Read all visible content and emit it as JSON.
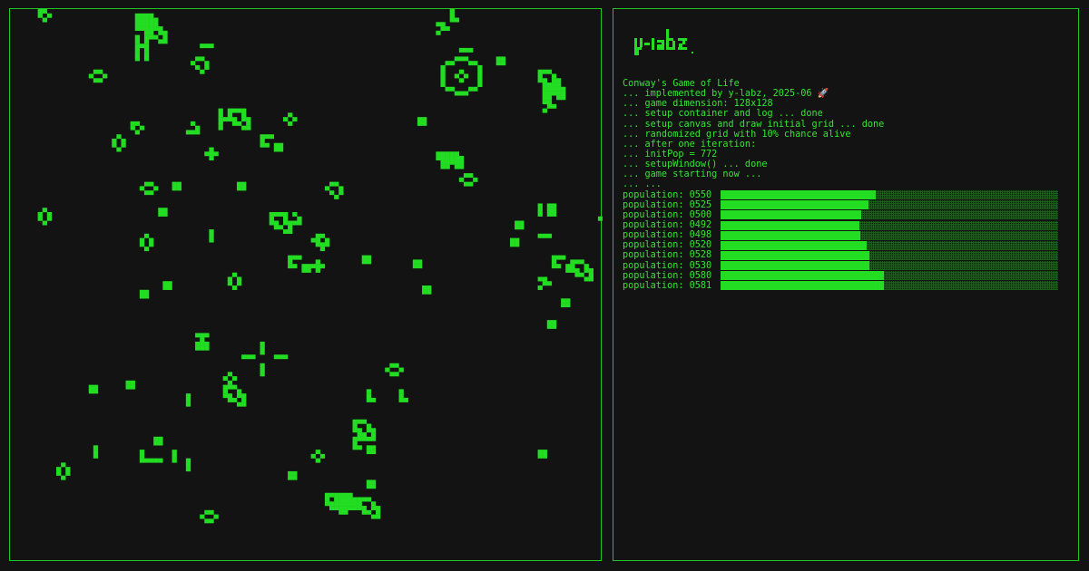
{
  "colors": {
    "background": "#131313",
    "accent": "#22dd22",
    "text": "#33e633",
    "bar_empty": "#1f5a1f"
  },
  "logo": {
    "text": "y-labz.",
    "style": "pixel-art"
  },
  "log": {
    "lines": [
      "Conway's Game of Life",
      "... implemented by y-labz, 2025-06 🚀",
      "... game dimension: 128x128",
      "... setup container and log ... done",
      "... setup canvas and draw initial grid ... done",
      "... randomized grid with 10% chance alive",
      "... after one iteration:",
      "... initPop = 772",
      "... setupWindow() ... done",
      "... game starting now ...",
      "... ..."
    ],
    "population_label": "population:",
    "population_max": 1200,
    "populations": [
      {
        "label": "0550",
        "value": 550
      },
      {
        "label": "0525",
        "value": 525
      },
      {
        "label": "0500",
        "value": 500
      },
      {
        "label": "0492",
        "value": 492
      },
      {
        "label": "0498",
        "value": 498
      },
      {
        "label": "0520",
        "value": 520
      },
      {
        "label": "0528",
        "value": 528
      },
      {
        "label": "0530",
        "value": 530
      },
      {
        "label": "0580",
        "value": 580
      },
      {
        "label": "0581",
        "value": 581
      }
    ]
  },
  "grid": {
    "size": 128,
    "live_color": "#22dd22"
  }
}
